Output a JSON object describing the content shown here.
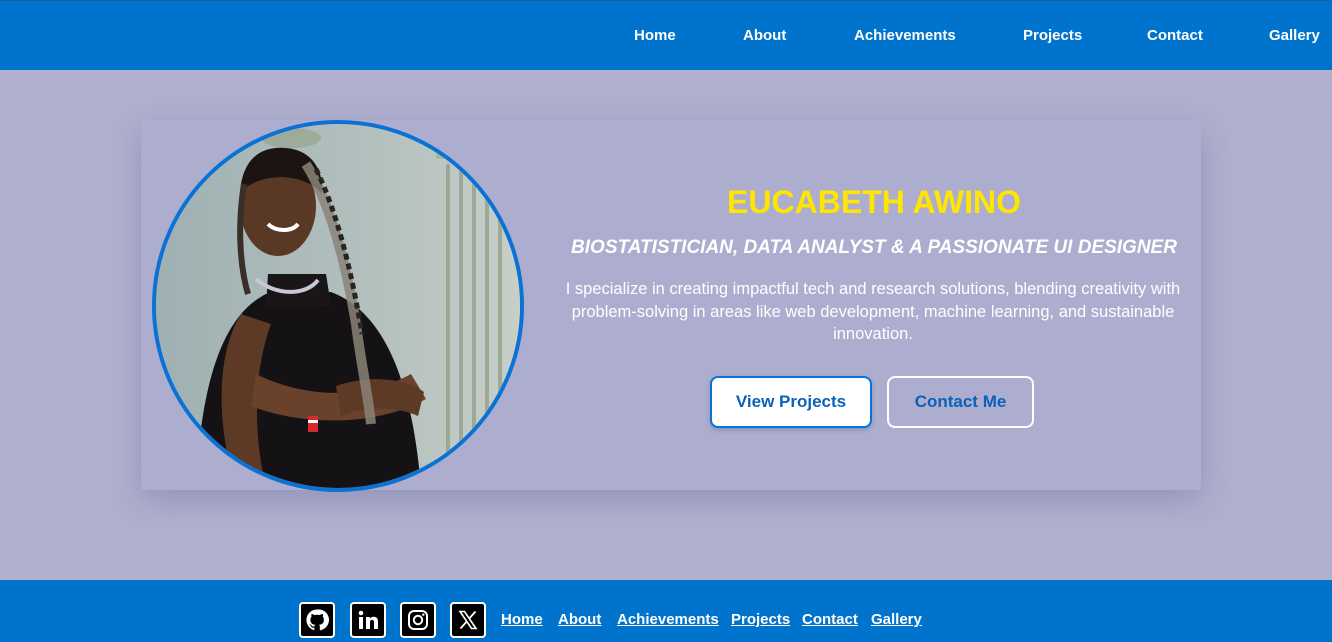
{
  "nav": {
    "items": [
      {
        "label": "Home"
      },
      {
        "label": "About"
      },
      {
        "label": "Achievements"
      },
      {
        "label": "Projects"
      },
      {
        "label": "Contact"
      },
      {
        "label": "Gallery"
      }
    ]
  },
  "hero": {
    "name": "EUCABETH AWINO",
    "tagline": "BIOSTATISTICIAN, DATA ANALYST & A PASSIONATE UI DESIGNER",
    "intro": "I specialize in creating impactful tech and research solutions, blending creativity with problem-solving in areas like web development, machine learning, and sustainable innovation.",
    "primary_button": "View Projects",
    "secondary_button": "Contact Me"
  },
  "footer": {
    "social": [
      {
        "icon": "github-icon"
      },
      {
        "icon": "linkedin-icon"
      },
      {
        "icon": "instagram-icon"
      },
      {
        "icon": "x-icon"
      }
    ],
    "links": [
      {
        "label": "Home"
      },
      {
        "label": "About"
      },
      {
        "label": "Achievements"
      },
      {
        "label": "Projects"
      },
      {
        "label": "Contact"
      },
      {
        "label": "Gallery"
      }
    ]
  },
  "colors": {
    "primary_blue": "#0074cc",
    "background": "#b0b0cf",
    "name_yellow": "#ffe600",
    "text_white": "#ffffff"
  }
}
